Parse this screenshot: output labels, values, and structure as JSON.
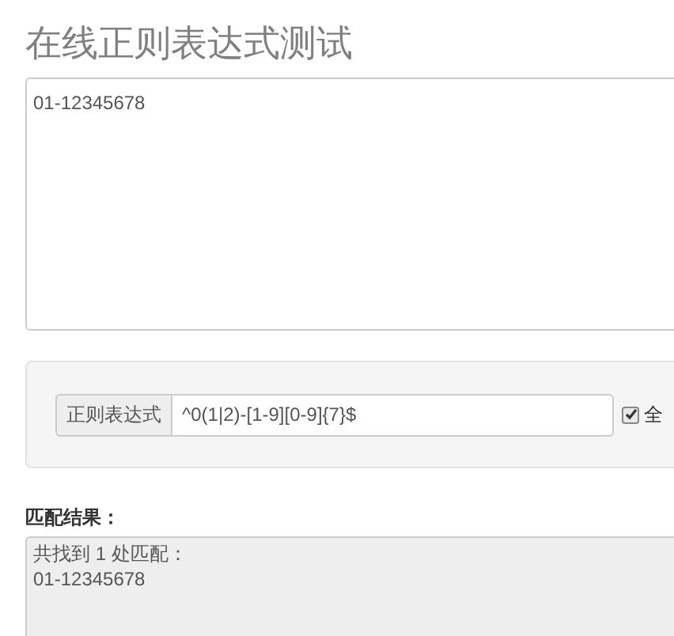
{
  "title": "在线正则表达式测试",
  "source_text": {
    "value": "01-12345678"
  },
  "regex": {
    "label": "正则表达式",
    "value": "^0(1|2)-[1-9][0-9]{7}$"
  },
  "options": [
    {
      "label": "全",
      "checked": true
    }
  ],
  "result": {
    "label": "匹配结果：",
    "lines": [
      "共找到 1 处匹配：",
      "01-12345678"
    ]
  }
}
